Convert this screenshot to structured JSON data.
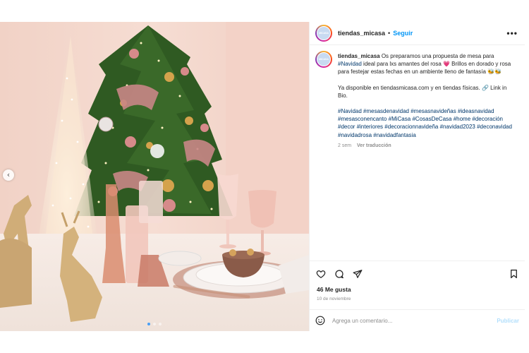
{
  "post": {
    "username": "tiendas_micasa",
    "separator": "•",
    "follow_label": "Seguir",
    "more_label": "•••",
    "avatar_text": "MICASA",
    "caption": {
      "username": "tiendas_micasa",
      "line1_before": " Os preparamos una propuesta de mesa para ",
      "line1_tag": "#Navidad",
      "line1_after": " ideal para lxs amantes del rosa 💗 Brillos en dorado y rosa para festejar estas fechas en un ambiente lleno de fantasía 🐝🐝",
      "paragraph2": "Ya disponible en tiendasmicasa.com y en tiendas físicas. 🔗 Link in Bio.",
      "hashtags": [
        "#Navidad",
        "#mesasdenavidad",
        "#mesasnavideñas",
        "#ideasnavidad",
        "#mesasconencanto",
        "#MiCasa",
        "#CosasDeCasa",
        "#home",
        "#decoración",
        "#decor",
        "#interiores",
        "#decoracionnavideña",
        "#navidad2023",
        "#deconavidad",
        "#navidadrosa",
        "#navidadfantasia"
      ],
      "age": "2 sem",
      "translate_label": "Ver traducción"
    },
    "likes": "46 Me gusta",
    "date": "10 de noviembre",
    "comment_placeholder": "Agrega un comentario...",
    "publish_label": "Publicar",
    "prev_label": "‹",
    "colors": {
      "accent": "#0095f6",
      "link": "#00376b",
      "muted": "#8e8e8e",
      "publish_disabled": "#b2dffc"
    }
  }
}
